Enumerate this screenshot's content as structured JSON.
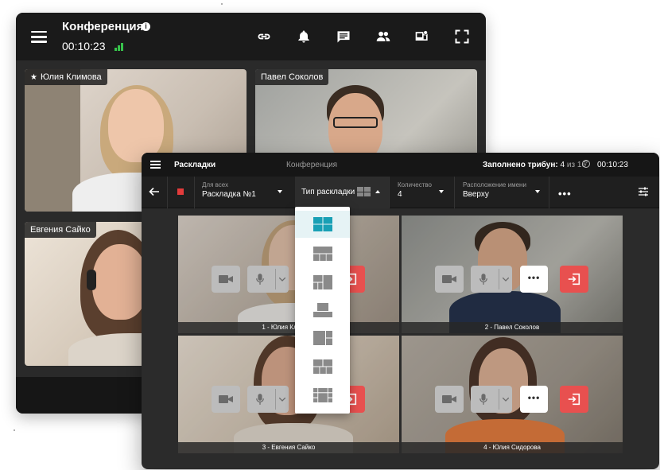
{
  "back_window": {
    "title": "Конференция",
    "timer": "00:10:23",
    "toolbar_icons": [
      "link-icon",
      "bell-icon",
      "chat-icon",
      "participants-icon",
      "screen-share-icon",
      "fullscreen-icon"
    ],
    "participants": [
      {
        "name": "Юлия Климова",
        "starred": true
      },
      {
        "name": "Павел Соколов",
        "starred": false
      },
      {
        "name": "Евгения Сайко",
        "starred": false
      }
    ]
  },
  "front_window": {
    "header": {
      "title": "Раскладки",
      "subtitle": "Конференция",
      "filled_label": "Заполнено трибун:",
      "filled_value": "4",
      "filled_of": "из 16",
      "timer": "00:10:23"
    },
    "toolbar": {
      "for_all_label": "Для всех",
      "for_all_value": "Раскладка №1",
      "layout_type_label": "Тип раскладки",
      "count_label": "Количество",
      "count_value": "4",
      "name_position_label": "Расположение имени",
      "name_position_value": "Вверху",
      "more": "•••"
    },
    "tiles": [
      {
        "caption": "1 - Юлия Климова"
      },
      {
        "caption": "2 - Павел Соколов"
      },
      {
        "caption": "3 - Евгения Сайко"
      },
      {
        "caption": "4 - Юлия Сидорова"
      }
    ],
    "tile_more": "•••",
    "layout_options": [
      "layout-grid-2x2-icon",
      "layout-top-wide-icon",
      "layout-side-split-icon",
      "layout-single-center-icon",
      "layout-right-stack-icon",
      "layout-grid-mixed-icon",
      "layout-mosaic-icon"
    ]
  },
  "colors": {
    "accent_teal": "#19a0b5",
    "exit_red": "#e8504f",
    "signal_green": "#37c24b",
    "stop_red": "#e33b3b"
  }
}
